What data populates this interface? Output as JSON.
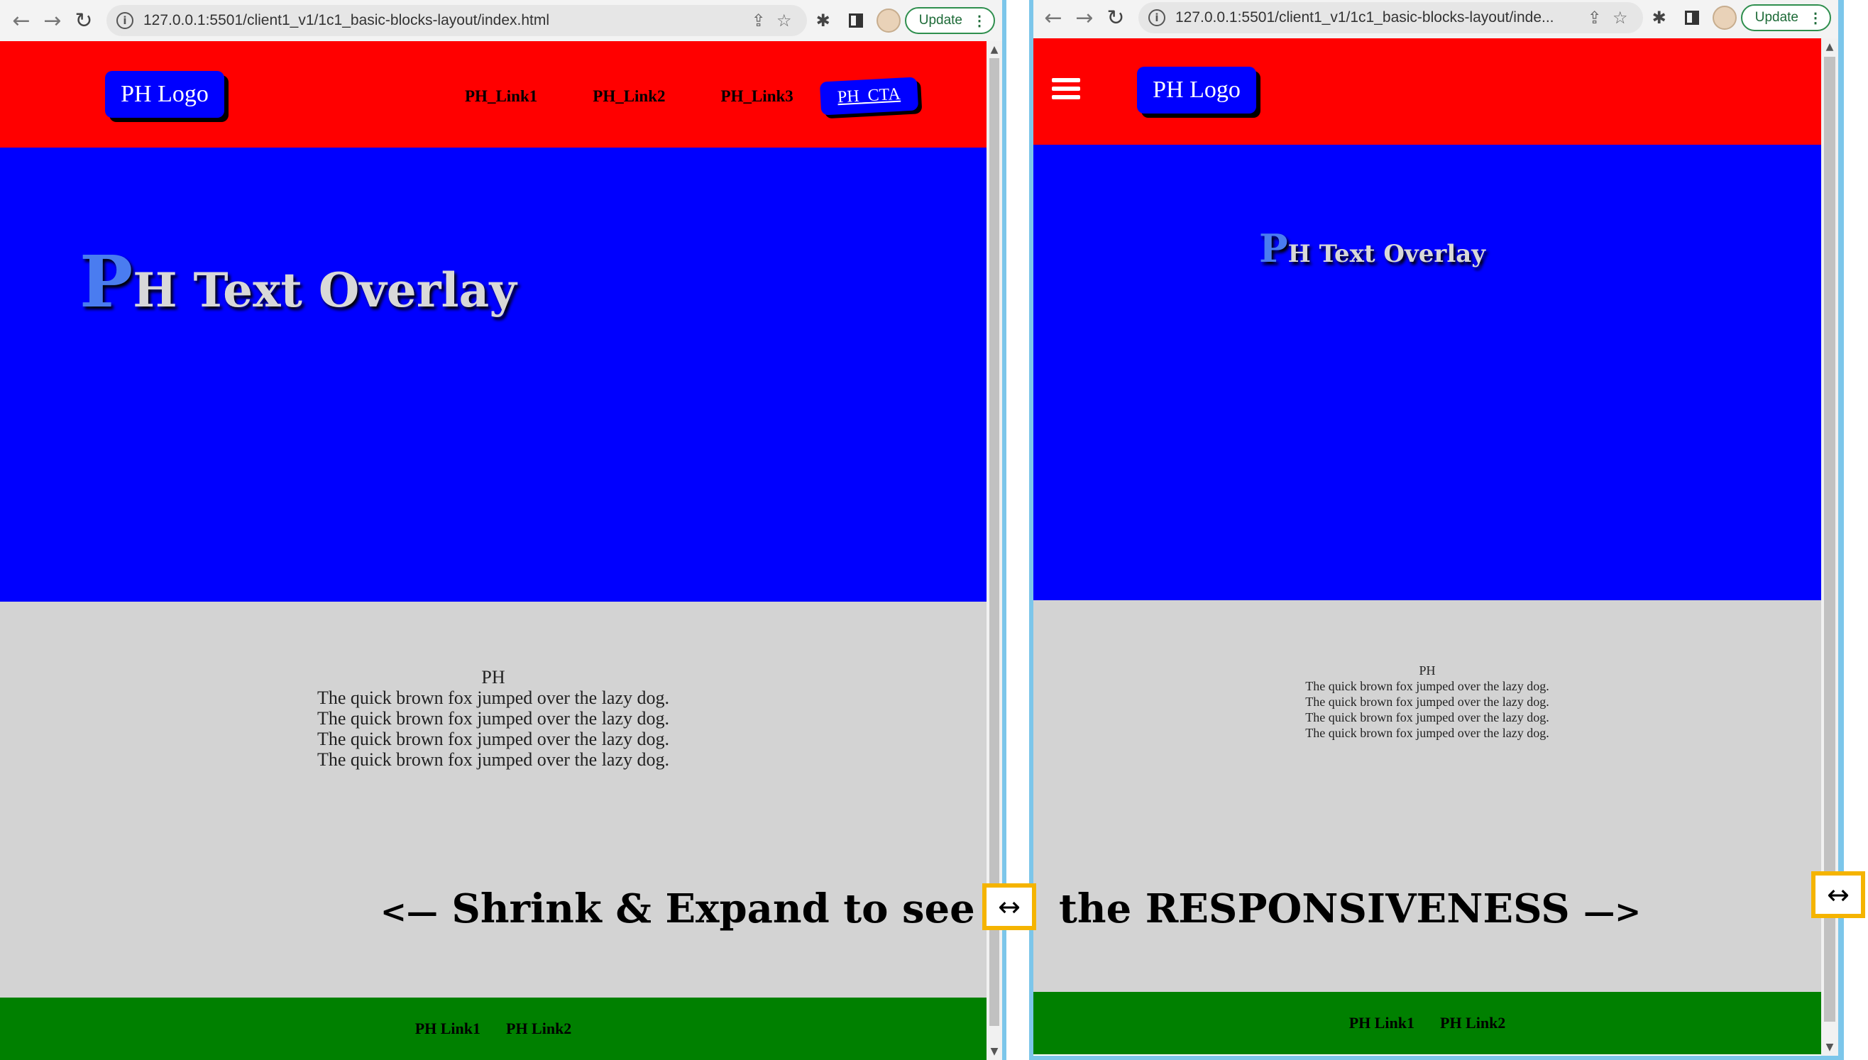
{
  "left_window": {
    "url": "127.0.0.1:5501/client1_v1/1c1_basic-blocks-layout/index.html",
    "update_label": "Update",
    "nav": {
      "logo": "PH Logo",
      "links": [
        "PH_Link1",
        "PH_Link2",
        "PH_Link3"
      ],
      "cta": "PH_CTA"
    },
    "hero": {
      "big_letter": "P",
      "title_rest": "H Text Overlay"
    },
    "content": {
      "heading": "PH",
      "lines": [
        "The quick brown fox jumped over the lazy dog.",
        "The quick brown fox jumped over the lazy dog.",
        "The quick brown fox jumped over the lazy dog.",
        "The quick brown fox jumped over the lazy dog."
      ]
    },
    "footer": {
      "links": [
        "PH Link1",
        "PH Link2"
      ]
    }
  },
  "right_window": {
    "url": "127.0.0.1:5501/client1_v1/1c1_basic-blocks-layout/inde...",
    "update_label": "Update",
    "nav": {
      "logo": "PH Logo"
    },
    "hero": {
      "big_letter": "P",
      "title_rest": "H Text Overlay"
    },
    "content": {
      "heading": "PH",
      "lines": [
        "The quick brown fox jumped over the lazy dog.",
        "The quick brown fox jumped over the lazy dog.",
        "The quick brown fox jumped over the lazy dog.",
        "The quick brown fox jumped over the lazy dog."
      ]
    },
    "footer": {
      "links": [
        "PH Link1",
        "PH Link2"
      ]
    }
  },
  "annotation": {
    "left_arrow": "<—",
    "left_text": "Shrink & Expand to see",
    "right_text": "the RESPONSIVENESS",
    "right_arrow": "—>",
    "resize_glyph": "↔"
  },
  "colors": {
    "nav_bg": "#ff0000",
    "hero_bg": "#0000ff",
    "content_bg": "#d3d3d3",
    "footer_bg": "#008000",
    "logo_bg": "#0000ff",
    "highlight_border": "#f5b400",
    "window_border": "#7cc6ea"
  },
  "icons": [
    "back-arrow-icon",
    "forward-arrow-icon",
    "reload-icon",
    "info-icon",
    "share-icon",
    "star-icon",
    "extensions-icon",
    "side-panel-icon",
    "avatar",
    "more-vert-icon",
    "hamburger-menu-icon",
    "resize-arrows-icon"
  ]
}
